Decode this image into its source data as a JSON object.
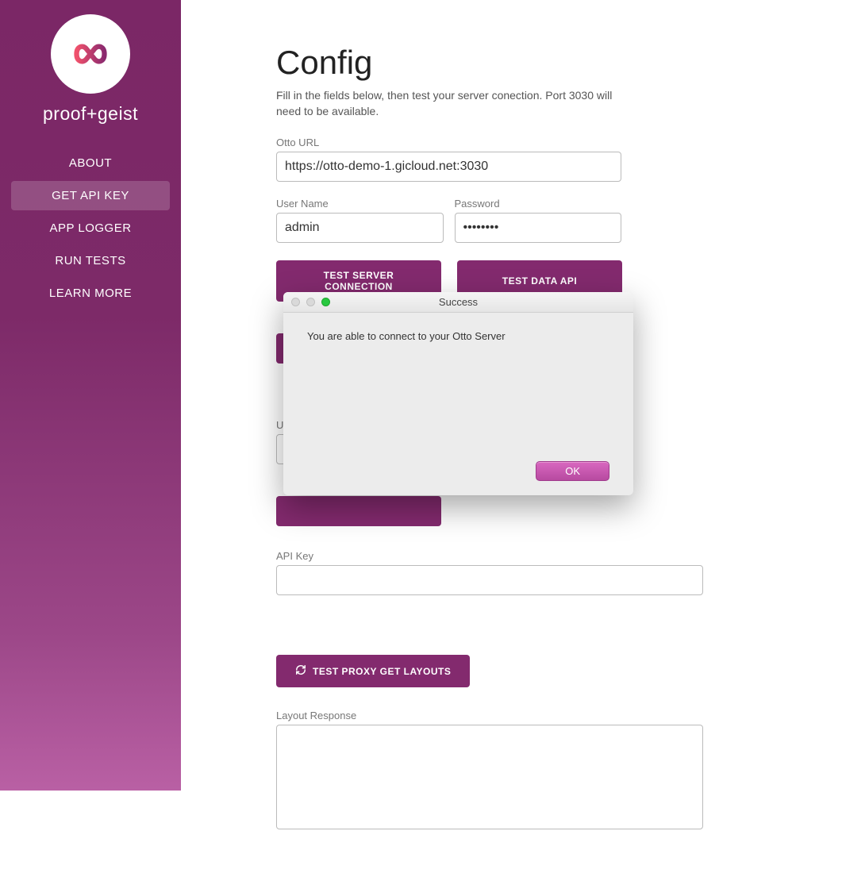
{
  "brand": {
    "name": "proof+geist"
  },
  "sidebar": {
    "items": [
      {
        "label": "ABOUT",
        "active": false
      },
      {
        "label": "GET API KEY",
        "active": true
      },
      {
        "label": "APP LOGGER",
        "active": false
      },
      {
        "label": "RUN TESTS",
        "active": false
      },
      {
        "label": "LEARN MORE",
        "active": false
      }
    ]
  },
  "page": {
    "title": "Config",
    "subtitle": "Fill in the fields below, then test your server conection. Port 3030 will need to be available."
  },
  "fields": {
    "otto_url": {
      "label": "Otto URL",
      "value": "https://otto-demo-1.gicloud.net:3030"
    },
    "username": {
      "label": "User Name",
      "value": "admin"
    },
    "password": {
      "label": "Password",
      "value": "••••••••"
    },
    "us_partial": {
      "label": "Us"
    },
    "api_key": {
      "label": "API Key",
      "value": ""
    },
    "layout_response": {
      "label": "Layout Response",
      "value": ""
    }
  },
  "buttons": {
    "test_server": "TEST SERVER CONNECTION",
    "test_data_api": "TEST DATA API",
    "test_proxy": "TEST PROXY GET LAYOUTS"
  },
  "dialog": {
    "title": "Success",
    "message": "You are able to connect to your Otto Server",
    "ok": "OK"
  }
}
